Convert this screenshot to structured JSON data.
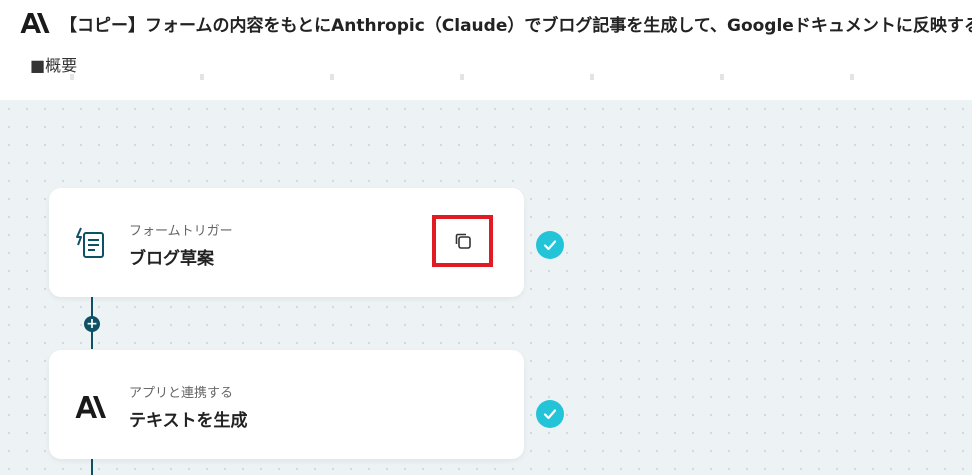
{
  "header": {
    "title": "【コピー】フォームの内容をもとにAnthropic（Claude）でブログ記事を生成して、Googleドキュメントに反映する",
    "overview_label": "■概要",
    "logo_icon": "anthropic-logo-icon"
  },
  "flow": {
    "steps": [
      {
        "subtitle": "フォームトリガー",
        "title": "ブログ草案",
        "icon": "form-trigger-icon",
        "status": "completed",
        "copy_icon": "copy-icon"
      },
      {
        "subtitle": "アプリと連携する",
        "title": "テキストを生成",
        "icon": "anthropic-logo-icon",
        "status": "completed"
      }
    ],
    "add_symbol": "+"
  },
  "colors": {
    "accent": "#0e5165",
    "check": "#24c4d8",
    "highlight": "#e01b24",
    "canvas_bg": "#edf3f4"
  }
}
